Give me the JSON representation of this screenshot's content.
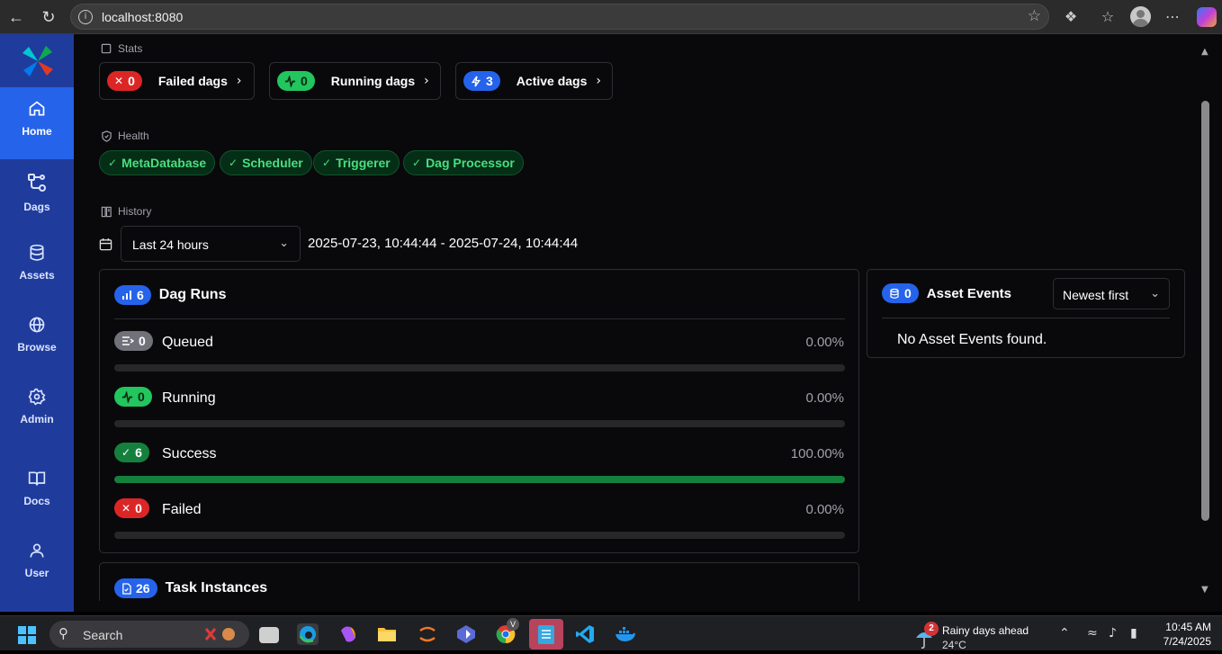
{
  "browser": {
    "url": "localhost:8080"
  },
  "sidebar": {
    "items": [
      {
        "label": "Home",
        "icon": "home-icon",
        "active": true
      },
      {
        "label": "Dags",
        "icon": "dags-icon"
      },
      {
        "label": "Assets",
        "icon": "database-icon"
      },
      {
        "label": "Browse",
        "icon": "globe-icon"
      },
      {
        "label": "Admin",
        "icon": "gear-icon"
      },
      {
        "label": "Docs",
        "icon": "book-icon"
      },
      {
        "label": "User",
        "icon": "user-icon"
      }
    ]
  },
  "stats": {
    "label": "Stats",
    "cards": [
      {
        "count": "0",
        "title": "Failed dags",
        "color": "#dc2626"
      },
      {
        "count": "0",
        "title": "Running dags",
        "color": "#22c55e"
      },
      {
        "count": "3",
        "title": "Active dags",
        "color": "#2563eb"
      }
    ]
  },
  "health": {
    "label": "Health",
    "items": [
      "MetaDatabase",
      "Scheduler",
      "Triggerer",
      "Dag Processor"
    ]
  },
  "history": {
    "label": "History",
    "range_select": "Last 24 hours",
    "date_range": "2025-07-23, 10:44:44 - 2025-07-24, 10:44:44"
  },
  "dag_runs": {
    "count": "6",
    "title": "Dag Runs",
    "rows": [
      {
        "count": "0",
        "name": "Queued",
        "pct": "0.00%",
        "fraction": 0
      },
      {
        "count": "0",
        "name": "Running",
        "pct": "0.00%",
        "fraction": 0
      },
      {
        "count": "6",
        "name": "Success",
        "pct": "100.00%",
        "fraction": 1
      },
      {
        "count": "0",
        "name": "Failed",
        "pct": "0.00%",
        "fraction": 0
      }
    ]
  },
  "task_instances": {
    "count": "26",
    "title": "Task Instances"
  },
  "asset_events": {
    "count": "0",
    "title": "Asset Events",
    "sort": "Newest first",
    "empty": "No Asset Events found."
  },
  "taskbar": {
    "search": "Search",
    "weather_badge": "2",
    "weather_title": "Rainy days ahead",
    "weather_temp": "24°C",
    "time": "10:45 AM",
    "date": "7/24/2025",
    "profile_badge": "V"
  }
}
